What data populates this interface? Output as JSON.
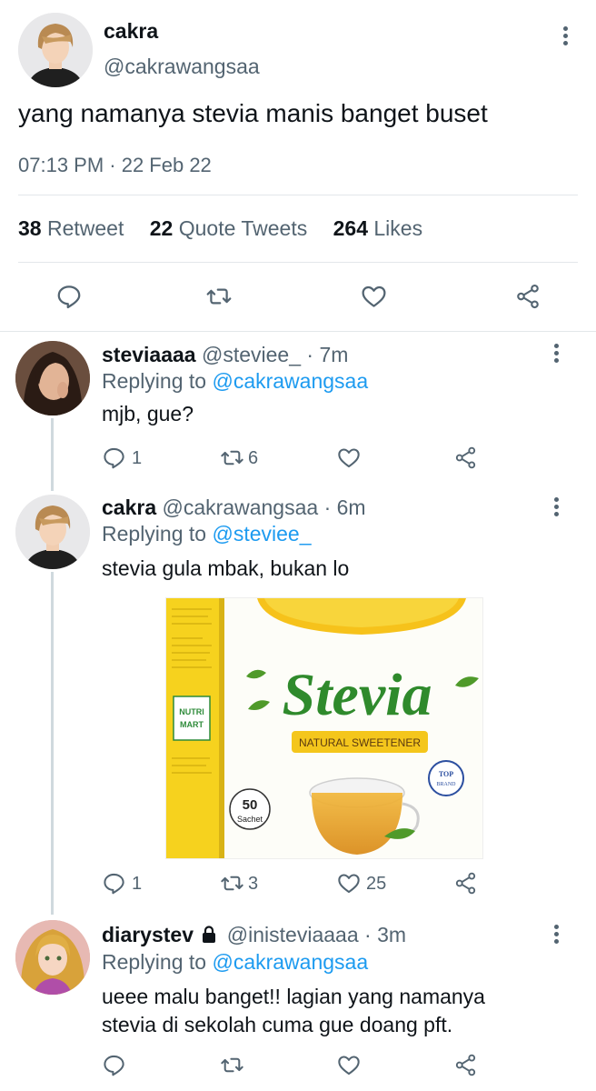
{
  "main_tweet": {
    "name": "cakra",
    "handle": "@cakrawangsaa",
    "text": "yang namanya stevia manis banget buset",
    "timestamp": "07:13 PM · 22 Feb 22",
    "stats": {
      "retweets_count": "38",
      "retweets_label": "Retweet",
      "quotes_count": "22",
      "quotes_label": "Quote Tweets",
      "likes_count": "264",
      "likes_label": "Likes"
    }
  },
  "replies": [
    {
      "name": "steviaaaa",
      "handle": "@steviee_",
      "time": "· 7m",
      "replying_prefix": "Replying to",
      "replying_to": "@cakrawangsaa",
      "text": "mjb, gue?",
      "reply_count": "1",
      "retweet_count": "6",
      "like_count": ""
    },
    {
      "name": "cakra",
      "handle": "@cakrawangsaa",
      "time": "· 6m",
      "replying_prefix": "Replying to",
      "replying_to": "@steviee_",
      "text": "stevia gula mbak, bukan lo",
      "reply_count": "1",
      "retweet_count": "3",
      "like_count": "25",
      "media": {
        "brand_title": "Stevia",
        "tagline": "NATURAL SWEETENER",
        "sachet_count": "50",
        "sachet_label": "Sachet",
        "badge_top": "TOP",
        "badge_bottom": "BRAND",
        "side_badge_top": "NUTRI",
        "side_badge_bottom": "MART"
      }
    },
    {
      "name": "diarystev",
      "handle": "@inisteviaaaa",
      "time": "· 3m",
      "replying_prefix": "Replying to",
      "replying_to": "@cakrawangsaa",
      "text_line1": "ueee malu banget!! lagian yang namanya",
      "text_line2": "stevia di sekolah cuma gue doang pft.",
      "reply_count": "",
      "retweet_count": "",
      "like_count": ""
    }
  ],
  "colors": {
    "text_primary": "#0f1419",
    "text_secondary": "#536471",
    "accent": "#1d9bf0",
    "divider": "#e3e7ea"
  }
}
